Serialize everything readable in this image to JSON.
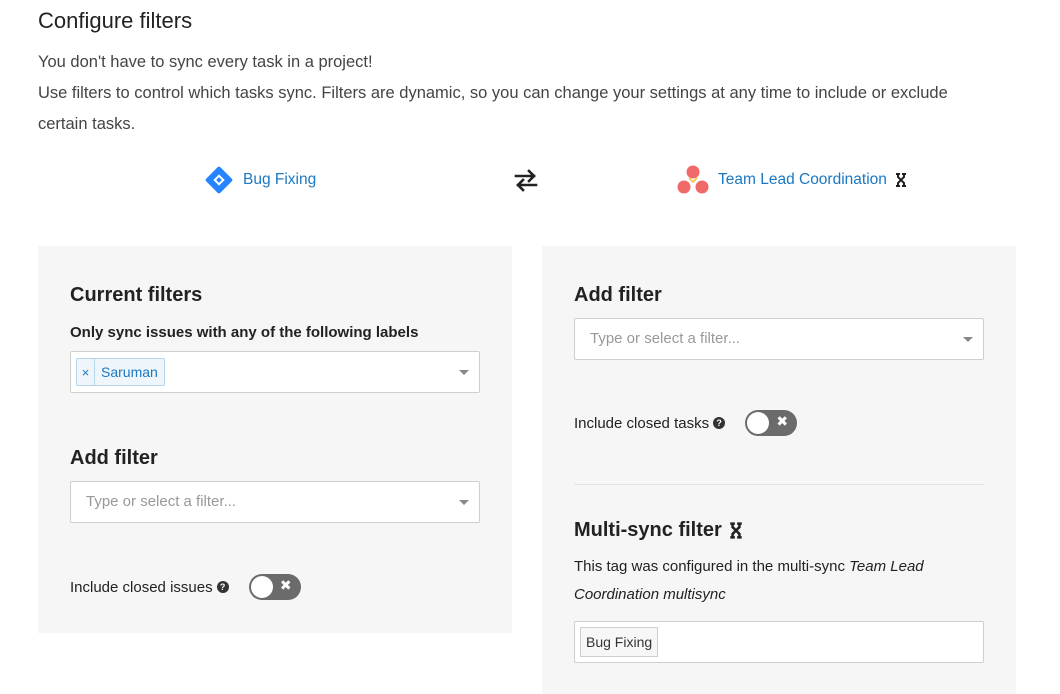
{
  "page": {
    "title": "Configure filters",
    "intro_line1": "You don't have to sync every task in a project!",
    "intro_line2": "Use filters to control which tasks sync. Filters are dynamic, so you can change your settings at any time to include or exclude certain tasks."
  },
  "projects": {
    "left_name": "Bug Fixing",
    "left_icon": "jira-icon",
    "right_name": "Team Lead Coordination",
    "right_icon": "asana-icon",
    "sync_icon": "sync-arrows-icon",
    "multisync_icon": "multisync-icon"
  },
  "left_panel": {
    "current_filters_title": "Current filters",
    "labels_filter_label": "Only sync issues with any of the following labels",
    "selected_tags": [
      "Saruman"
    ],
    "tag_remove_symbol": "×",
    "add_filter_title": "Add filter",
    "add_filter_placeholder": "Type or select a filter...",
    "include_closed_label": "Include closed issues",
    "include_closed_enabled": false
  },
  "right_panel": {
    "add_filter_title": "Add filter",
    "add_filter_placeholder": "Type or select a filter...",
    "include_closed_label": "Include closed tasks",
    "include_closed_enabled": false,
    "multisync_title": "Multi-sync filter",
    "multisync_desc_prefix": "This tag was configured in the multi-sync ",
    "multisync_desc_name": "Team Lead Coordination multisync",
    "multisync_tag": "Bug Fixing"
  },
  "colors": {
    "link": "#1b78c2",
    "panel_bg": "#f6f6f6",
    "toggle_off": "#6b6b6b",
    "jira_blue": "#2684ff",
    "asana_pink": "#f06a6a"
  }
}
